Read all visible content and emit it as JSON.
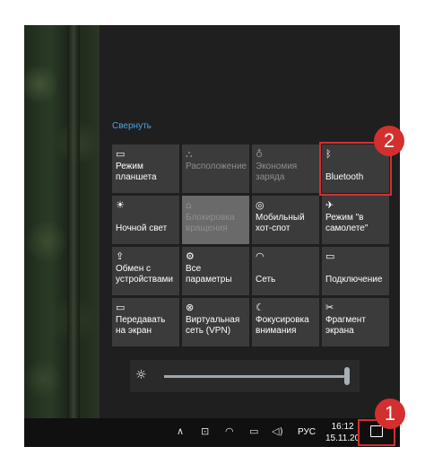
{
  "action_center": {
    "collapse_label": "Свернуть",
    "tiles": [
      {
        "label": "Режим планшета",
        "icon": "tablet-mode-icon",
        "glyph": "▭"
      },
      {
        "label": "Расположение",
        "icon": "location-icon",
        "glyph": "⛬"
      },
      {
        "label": "Экономия заряда",
        "icon": "battery-saver-icon",
        "glyph": "♁"
      },
      {
        "label": "Bluetooth",
        "icon": "bluetooth-icon",
        "glyph": "ᛒ"
      },
      {
        "label": "Ночной свет",
        "icon": "night-light-icon",
        "glyph": "☀"
      },
      {
        "label": "Блокировка вращения",
        "icon": "rotation-lock-icon",
        "glyph": "⌂"
      },
      {
        "label": "Мобильный хот-спот",
        "icon": "mobile-hotspot-icon",
        "glyph": "◎"
      },
      {
        "label": "Режим \"в самолете\"",
        "icon": "airplane-icon",
        "glyph": "✈"
      },
      {
        "label": "Обмен с устройствами",
        "icon": "nearby-sharing-icon",
        "glyph": "⇪"
      },
      {
        "label": "Все параметры",
        "icon": "settings-gear-icon",
        "glyph": "⚙"
      },
      {
        "label": "Сеть",
        "icon": "network-icon",
        "glyph": "◠"
      },
      {
        "label": "Подключение",
        "icon": "connect-icon",
        "glyph": "▭"
      },
      {
        "label": "Передавать на экран",
        "icon": "project-icon",
        "glyph": "▭"
      },
      {
        "label": "Виртуальная сеть (VPN)",
        "icon": "vpn-icon",
        "glyph": "⊗"
      },
      {
        "label": "Фокусировка внимания",
        "icon": "focus-assist-icon",
        "glyph": "☾"
      },
      {
        "label": "Фрагмент экрана",
        "icon": "screen-snip-icon",
        "glyph": "✂"
      }
    ],
    "brightness": {
      "icon": "brightness-icon",
      "glyph": "☼",
      "level_percent": 100
    }
  },
  "taskbar": {
    "chevron_glyph": "∧",
    "meet_glyph": "⊡",
    "wifi_glyph": "◠",
    "battery_glyph": "▭",
    "volume_glyph": "◁)",
    "language": "РУС",
    "time": "16:12",
    "date": "15.11.20"
  },
  "annotations": {
    "badge_1": "1",
    "badge_2": "2"
  },
  "colors": {
    "accent": "#4aa3e8",
    "highlight": "#d32f2f",
    "tile": "#3b3b3b"
  }
}
